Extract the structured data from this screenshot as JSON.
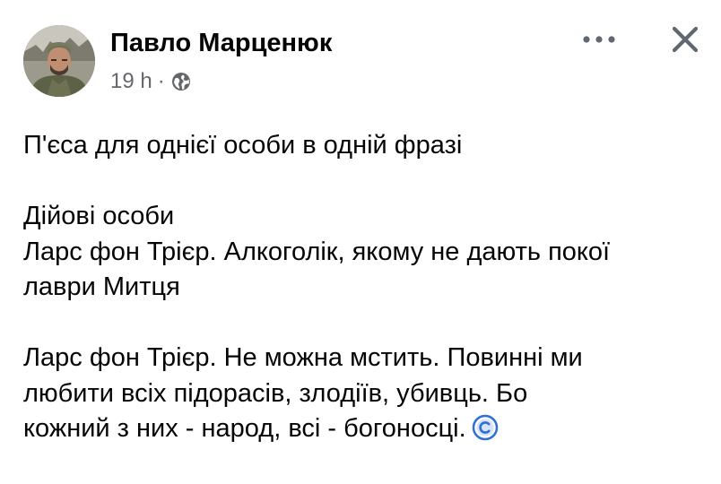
{
  "post": {
    "author_name": "Павло Марценюк",
    "timestamp": "19 h",
    "separator": "·",
    "privacy_icon": "globe-icon",
    "more_icon": "more-options-icon",
    "close_icon": "close-icon",
    "paragraphs": [
      {
        "lines": [
          "П'єса для однієї особи  в одній фразі"
        ]
      },
      {
        "lines": [
          "Дійові особи",
          "Ларс фон Трієр. Алкоголік, якому не дають покої",
          "лаври Митця"
        ]
      },
      {
        "lines": [
          "Ларс фон Трієр.  Не можна мстить. Повинні ми",
          "любити всіх підорасів, злодіїв, убивць. Бо",
          "кожний з них - народ, всі - богоносці."
        ]
      }
    ],
    "trailing_emoji": "copyright-emoji",
    "colors": {
      "text": "#050505",
      "secondary_text": "#65676b",
      "icon": "#606770",
      "emoji_blue": "#2f6fd6"
    }
  }
}
